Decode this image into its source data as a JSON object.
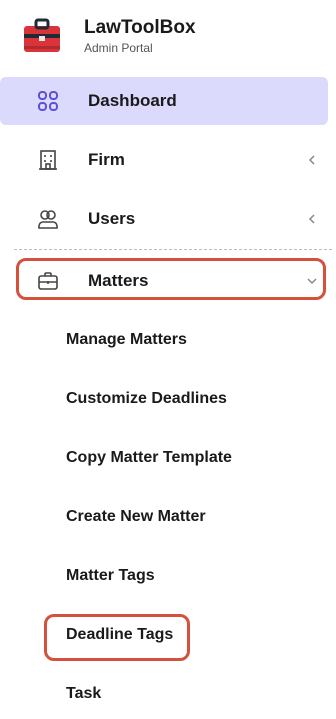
{
  "brand": {
    "name": "LawToolBox",
    "subtitle": "Admin Portal",
    "logo_icon": "toolbox-icon",
    "logo_color": "#d8343a"
  },
  "nav": {
    "dashboard": {
      "label": "Dashboard",
      "icon": "grid-icon"
    },
    "firm": {
      "label": "Firm",
      "icon": "building-icon"
    },
    "users": {
      "label": "Users",
      "icon": "users-icon"
    },
    "matters": {
      "label": "Matters",
      "icon": "briefcase-icon"
    }
  },
  "matters_submenu": [
    "Manage Matters",
    "Customize Deadlines",
    "Copy Matter Template",
    "Create New Matter",
    "Matter Tags",
    "Deadline Tags",
    "Task"
  ],
  "colors": {
    "active_bg": "#dcdafc",
    "active_icon": "#5b50d6",
    "highlight": "#d4523d"
  }
}
